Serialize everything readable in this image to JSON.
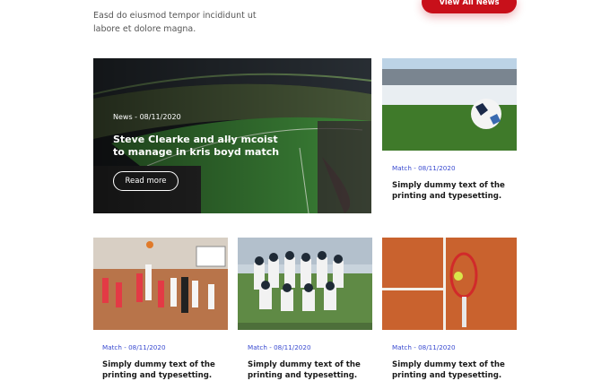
{
  "intro": {
    "text": "Easd do eiusmod tempor incididunt ut labore et dolore magna."
  },
  "header": {
    "view_all_label": "View All News"
  },
  "featured": {
    "meta": "News - 08/11/2020",
    "title": "Steve Clearke and ally mcoist to manage in kris boyd match",
    "read_more_label": "Read more"
  },
  "cards": [
    {
      "meta": "Match - 08/11/2020",
      "title": "Simply dummy text of the printing and typesetting."
    },
    {
      "meta": "Match - 08/11/2020",
      "title": "Simply dummy text of the printing and typesetting."
    },
    {
      "meta": "Match - 08/11/2020",
      "title": "Simply dummy text of the printing and typesetting."
    },
    {
      "meta": "Match - 08/11/2020",
      "title": "Simply dummy text of the printing and typesetting."
    }
  ],
  "colors": {
    "accent": "#c8101a",
    "meta": "#3a4bd0"
  }
}
